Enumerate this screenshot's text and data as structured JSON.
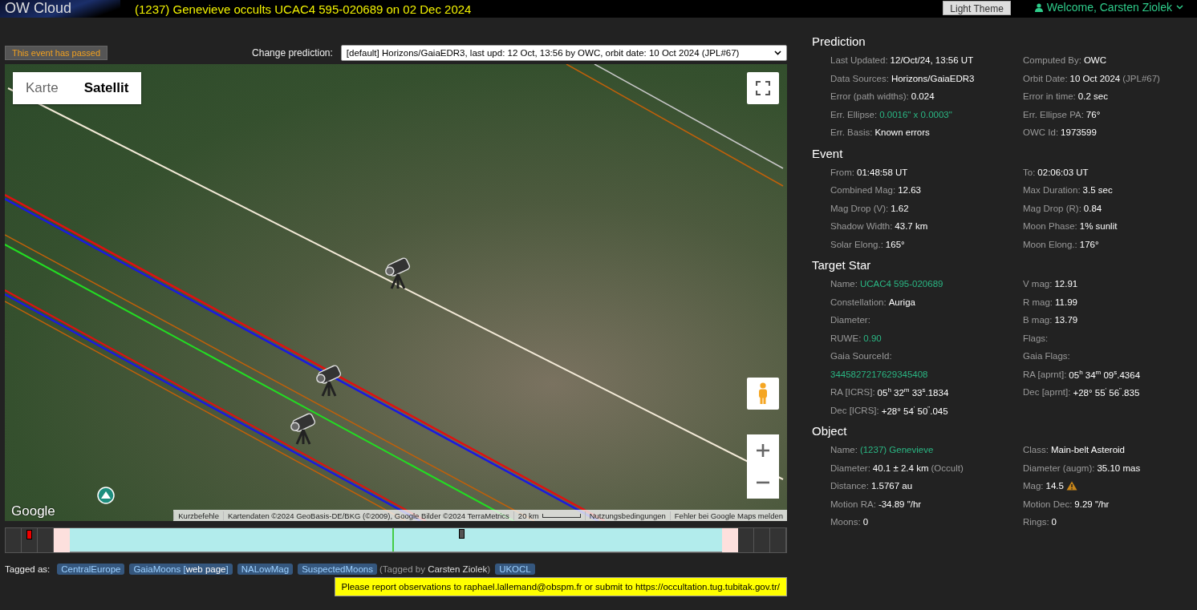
{
  "header": {
    "logo": "OW Cloud",
    "title": "(1237) Genevieve occults UCAC4 595-020689 on 02 Dec 2024",
    "theme_button": "Light Theme",
    "welcome": "Welcome, Carsten Ziolek"
  },
  "event_status": "This event has passed",
  "prediction_select": {
    "label": "Change prediction:",
    "value": "[default] Horizons/GaiaEDR3, last upd: 12 Oct, 13:56 by OWC, orbit date: 10 Oct 2024 (JPL#67)"
  },
  "map": {
    "map_types": [
      {
        "label": "Karte",
        "selected": false
      },
      {
        "label": "Satellit",
        "selected": true
      }
    ],
    "logo": "Google",
    "attribution": [
      {
        "kind": "text",
        "text": "Kurzbefehle"
      },
      {
        "kind": "text",
        "text": "Kartendaten ©2024 GeoBasis-DE/BKG (©2009), Google Bilder ©2024 TerraMetrics"
      },
      {
        "kind": "scale",
        "text": "20 km"
      },
      {
        "kind": "text",
        "text": "Nutzungsbedingungen"
      },
      {
        "kind": "text",
        "text": "Fehler bei Google Maps melden"
      }
    ]
  },
  "tags": {
    "label": "Tagged as:",
    "items": [
      {
        "label": "CentralEurope"
      },
      {
        "label": "GaiaMoons [**web page**]"
      },
      {
        "label": "NALowMag"
      },
      {
        "label": "SuspectedMoons",
        "note": "(Tagged by **Carsten Ziolek**)"
      },
      {
        "label": "UKOCL"
      }
    ]
  },
  "notice": "Please report observations to raphael.lallemand@obspm.fr or submit to https://occultation.tug.tubitak.gov.tr/",
  "sections": [
    {
      "title": "Prediction",
      "items": [
        {
          "label": "Last Updated:",
          "value": "12/Oct/24, 13:56 UT"
        },
        {
          "label": "Computed By:",
          "value": "OWC"
        },
        {
          "label": "Data Sources:",
          "value": "Horizons/GaiaEDR3"
        },
        {
          "label": "Orbit Date:",
          "value": "10 Oct 2024",
          "note": "(JPL#67)"
        },
        {
          "label": "Error (path widths):",
          "value": "0.024"
        },
        {
          "label": "Error in time:",
          "value": "0.2 sec"
        },
        {
          "label": "Err. Ellipse:",
          "value": "0.0016\" x 0.0003\"",
          "link": true
        },
        {
          "label": "Err. Ellipse PA:",
          "value": "76°"
        },
        {
          "label": "Err. Basis:",
          "value": "Known errors"
        },
        {
          "label": "OWC Id:",
          "value": "1973599"
        }
      ]
    },
    {
      "title": "Event",
      "items": [
        {
          "label": "From:",
          "value": "01:48:58 UT"
        },
        {
          "label": "To:",
          "value": "02:06:03 UT"
        },
        {
          "label": "Combined Mag:",
          "value": "12.63"
        },
        {
          "label": "Max Duration:",
          "value": "3.5 sec"
        },
        {
          "label": "Mag Drop (V):",
          "value": "1.62"
        },
        {
          "label": "Mag Drop (R):",
          "value": "0.84"
        },
        {
          "label": "Shadow Width:",
          "value": "43.7 km"
        },
        {
          "label": "Moon Phase:",
          "value": "1% sunlit"
        },
        {
          "label": "Solar Elong.:",
          "value": "165°"
        },
        {
          "label": "Moon Elong.:",
          "value": "176°"
        }
      ]
    },
    {
      "title": "Target Star",
      "items": [
        {
          "label": "Name:",
          "value": "UCAC4 595-020689",
          "link": true
        },
        {
          "label": "V mag:",
          "value": "12.91"
        },
        {
          "label": "Constellation:",
          "value": "Auriga"
        },
        {
          "label": "R mag:",
          "value": "11.99"
        },
        {
          "label": "Diameter:"
        },
        {
          "label": "B mag:",
          "value": "13.79"
        },
        {
          "label": "RUWE:",
          "value": "0.90",
          "link": true
        },
        {
          "label": "Flags:"
        },
        {
          "label": "Gaia SourceId:"
        },
        {
          "label": "Gaia Flags:"
        },
        {
          "value": "3445827217629345408",
          "link": true
        },
        {
          "label": "RA [aprnt]:",
          "value": "05$^{h}$ 34$^{m}$ 09$^{s}$.4364"
        },
        {
          "label": "RA [ICRS]:",
          "value": "05$^{h}$ 32$^{m}$ 33$^{s}$.1834"
        },
        {
          "label": "Dec [aprnt]:",
          "value": "+28° 55$^{'}$ 56$^{\"}$.835"
        },
        {
          "label": "Dec [ICRS]:",
          "value": "+28° 54$^{'}$ 50$^{\"}$.045"
        }
      ]
    },
    {
      "title": "Object",
      "items": [
        {
          "label": "Name:",
          "value": "(1237) Genevieve",
          "link": true
        },
        {
          "label": "Class:",
          "value": "Main-belt Asteroid"
        },
        {
          "label": "Diameter:",
          "value": "40.1 ± 2.4 km",
          "note": "(Occult)"
        },
        {
          "label": "Diameter (augm):",
          "value": "35.10 mas"
        },
        {
          "label": "Distance:",
          "value": "1.5767 au"
        },
        {
          "label": "Mag:",
          "value": "14.5",
          "warning": true
        },
        {
          "label": "Motion RA:",
          "value": "-34.89 \"/hr"
        },
        {
          "label": "Motion Dec:",
          "value": "9.29 \"/hr"
        },
        {
          "label": "Moons:",
          "value": "0"
        },
        {
          "label": "Rings:",
          "value": "0"
        }
      ]
    }
  ]
}
